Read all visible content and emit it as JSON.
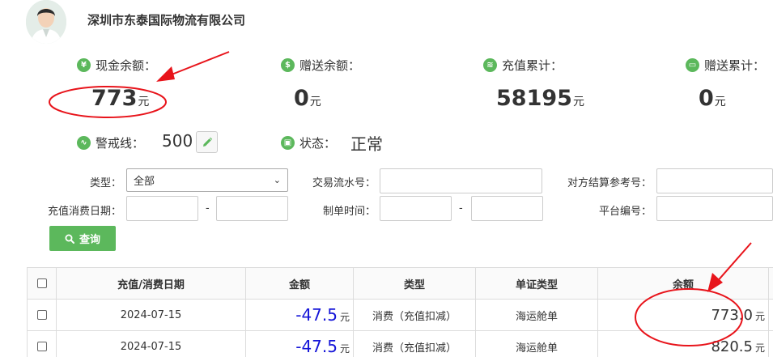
{
  "header": {
    "company_name": "深圳市东泰国际物流有限公司"
  },
  "stats": {
    "cash_balance": {
      "icon": "yen-icon",
      "label": "现金余额：",
      "value": "773",
      "unit": "元"
    },
    "gift_balance": {
      "icon": "money-bag-icon",
      "label": "赠送余额：",
      "value": "0",
      "unit": "元"
    },
    "recharge_total": {
      "icon": "cash-icon",
      "label": "充值累计：",
      "value": "58195",
      "unit": "元"
    },
    "gift_total": {
      "icon": "card-icon",
      "label": "赠送累计：",
      "value": "0",
      "unit": "元"
    },
    "warning_line": {
      "icon": "pulse-icon",
      "label": "警戒线：",
      "value": "500"
    },
    "status": {
      "icon": "briefcase-icon",
      "label": "状态：",
      "value": "正常"
    }
  },
  "filters": {
    "type_label": "类型：",
    "type_value": "全部",
    "txn_no_label": "交易流水号：",
    "counterparty_ref_label": "对方结算参考号：",
    "date_label": "充值消费日期：",
    "range_dash": "-",
    "created_time_label": "制单时间：",
    "platform_no_label": "平台编号：",
    "query_button": "查询"
  },
  "table": {
    "columns": [
      "充值/消费日期",
      "金额",
      "类型",
      "单证类型",
      "余额"
    ],
    "rows": [
      {
        "date": "2024-07-15",
        "amount": "-47.5",
        "amount_unit": "元",
        "type": "消费（充值扣减）",
        "doc_type": "海运舱单",
        "balance": "773.0",
        "balance_unit": "元",
        "extra": "5"
      },
      {
        "date": "2024-07-15",
        "amount": "-47.5",
        "amount_unit": "元",
        "type": "消费（充值扣减）",
        "doc_type": "海运舱单",
        "balance": "820.5",
        "balance_unit": "元",
        "extra": "5"
      }
    ]
  },
  "colors": {
    "accent_green": "#5cb85c",
    "amount_blue": "#1515d8",
    "annotation_red": "#e8141b"
  }
}
